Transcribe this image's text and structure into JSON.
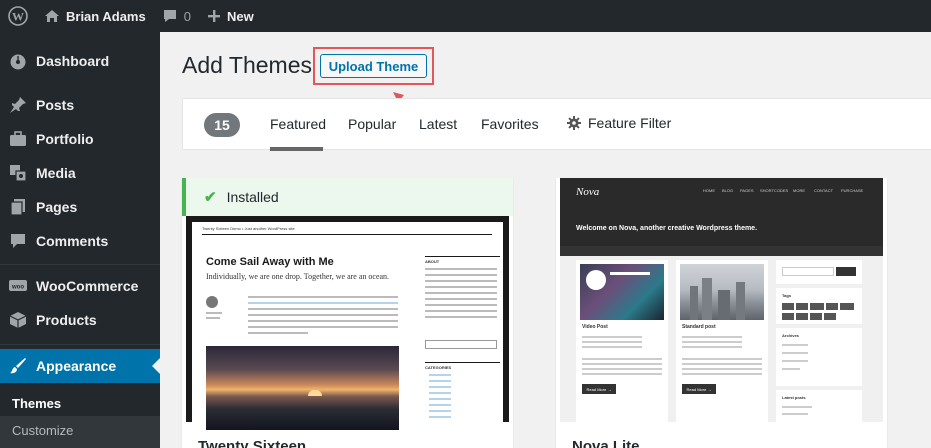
{
  "admin_bar": {
    "site_name": "Brian Adams",
    "comments_count": "0",
    "new_label": "New"
  },
  "sidebar": {
    "items": [
      {
        "label": "Dashboard",
        "icon": "dashboard-icon"
      },
      {
        "label": "Posts",
        "icon": "pin-icon"
      },
      {
        "label": "Portfolio",
        "icon": "briefcase-icon"
      },
      {
        "label": "Media",
        "icon": "media-icon"
      },
      {
        "label": "Pages",
        "icon": "pages-icon"
      },
      {
        "label": "Comments",
        "icon": "comment-icon"
      },
      {
        "label": "WooCommerce",
        "icon": "woocommerce-icon"
      },
      {
        "label": "Products",
        "icon": "products-icon"
      },
      {
        "label": "Appearance",
        "icon": "paintbrush-icon",
        "active": true
      }
    ],
    "submenu": [
      {
        "label": "Themes",
        "current": true
      },
      {
        "label": "Customize"
      }
    ]
  },
  "main": {
    "title": "Add Themes",
    "upload_button": "Upload Theme",
    "theme_count": "15",
    "tabs": [
      {
        "label": "Featured",
        "current": true
      },
      {
        "label": "Popular"
      },
      {
        "label": "Latest"
      },
      {
        "label": "Favorites"
      }
    ],
    "feature_filter": "Feature Filter"
  },
  "themes": [
    {
      "name": "Twenty Sixteen",
      "installed_label": "Installed",
      "preview": {
        "site_title": "Twenty Sixteen Demo • Just another WordPress site",
        "post_title": "Come Sail Away with Me",
        "lead": "Individually, we are one drop. Together, we are an ocean.",
        "sidebar_headings": [
          "ABOUT",
          "CATEGORIES"
        ]
      }
    },
    {
      "name": "Nova Lite",
      "preview": {
        "logo": "Nova",
        "nav": [
          "HOME",
          "BLOG",
          "PAGES",
          "SHORTCODES",
          "MORE",
          "CONTACT",
          "PURCHASE"
        ],
        "welcome": "Welcome on Nova, another creative Wordpress theme.",
        "post_titles": [
          "Video Post",
          "Standard post"
        ],
        "button": "Read More →",
        "widget_headings": [
          "Tags",
          "Archives",
          "Latest posts"
        ]
      }
    }
  ],
  "colors": {
    "admin_bg": "#23282d",
    "active_menu": "#0073aa",
    "highlight_box": "#e2585a",
    "installed_green": "#46b450"
  }
}
